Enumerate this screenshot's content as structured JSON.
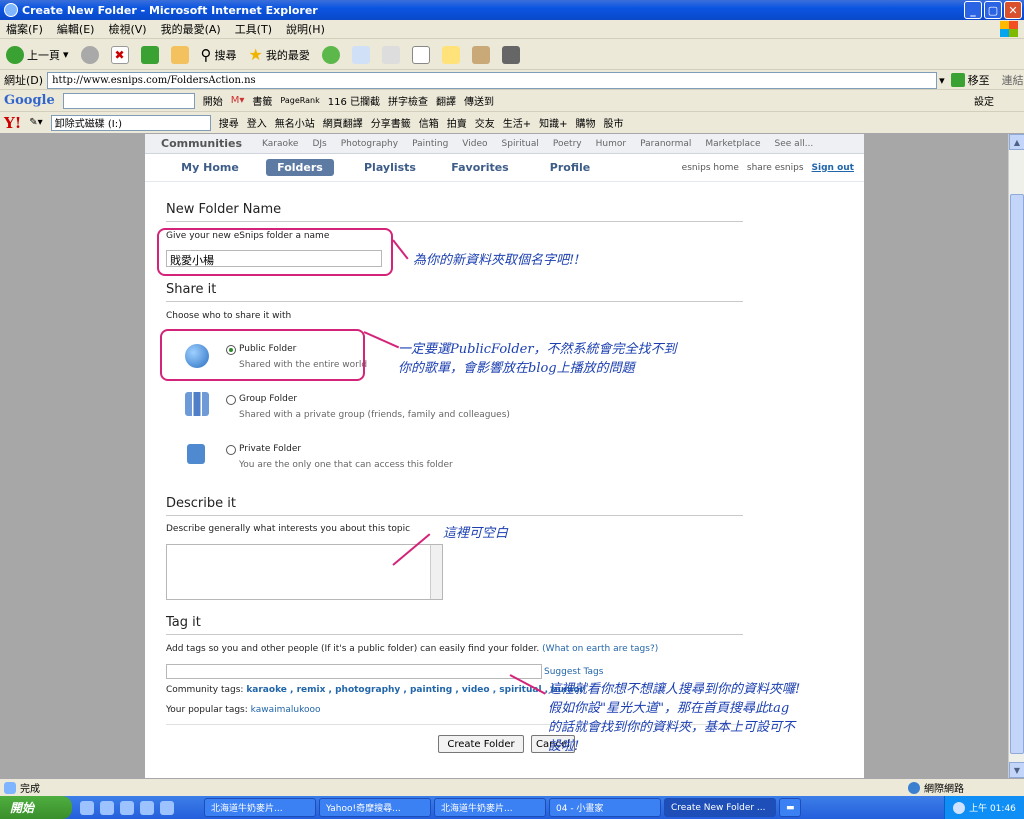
{
  "window": {
    "title": "Create New Folder - Microsoft Internet Explorer"
  },
  "menu": [
    "檔案(F)",
    "編輯(E)",
    "檢視(V)",
    "我的最愛(A)",
    "工具(T)",
    "說明(H)"
  ],
  "toolbar": {
    "back": "上一頁",
    "search": "搜尋",
    "favorites": "我的最愛"
  },
  "address": {
    "label": "網址(D)",
    "url": "http://www.esnips.com/FoldersAction.ns",
    "go": "移至",
    "links": "連結"
  },
  "google_bar": {
    "logo": "Google",
    "search_button": "開始",
    "pagerank": "PageRank",
    "blocked": "116 已攔截",
    "spell": "拼字檢查",
    "translate": "翻譯",
    "send": "傳送到",
    "settings": "設定",
    "bookmarks": "書籤"
  },
  "yahoo_bar": {
    "logo": "Y!",
    "input": "卸除式磁碟 (I:)",
    "search": "搜尋",
    "login": "登入",
    "items": [
      "無名小站",
      "網頁翻譯",
      "分享書籤",
      "信箱",
      "拍賣",
      "交友",
      "生活+",
      "知識+",
      "購物",
      "股市"
    ]
  },
  "community_nav": {
    "title": "Communities",
    "items": [
      "Karaoke",
      "DJs",
      "Photography",
      "Painting",
      "Video",
      "Spiritual",
      "Poetry",
      "Humor",
      "Paranormal",
      "Marketplace",
      "See all..."
    ]
  },
  "main_nav": {
    "tabs": [
      "My Home",
      "Folders",
      "Playlists",
      "Favorites",
      "Profile"
    ],
    "right": [
      "esnips home",
      "share esnips",
      "Sign out"
    ]
  },
  "form": {
    "name_title": "New Folder Name",
    "name_hint": "Give your new eSnips folder a name",
    "name_value": "戝愛小楊",
    "share_title": "Share it",
    "share_hint": "Choose who to share it with",
    "options": [
      {
        "title": "Public Folder",
        "desc": "Shared with the entire world",
        "selected": true
      },
      {
        "title": "Group Folder",
        "desc": "Shared with a private group (friends, family and colleagues)",
        "selected": false
      },
      {
        "title": "Private Folder",
        "desc": "You are the only one that can access this folder",
        "selected": false
      }
    ],
    "describe_title": "Describe it",
    "describe_hint": "Describe generally what interests you about this topic",
    "tag_title": "Tag it",
    "tag_hint": "Add tags so you and other people (If it's a public folder) can easily find your folder.",
    "tag_help": "(What on earth are tags?)",
    "suggest": "Suggest Tags",
    "community_tags_label": "Community tags:",
    "community_tags": "karaoke , remix , photography , painting , video , spiritual , humor",
    "popular_tags_label": "Your popular tags:",
    "popular_tags": "kawaimalukooo",
    "create": "Create Folder",
    "cancel": "Cancel"
  },
  "annotations": {
    "a1": "為你的新資料夾取個名字吧!!",
    "a2_l1": "一定要選PublicFolder，不然系統會完全找不到",
    "a2_l2": "你的歌單，會影響放在blog上播放的問題",
    "a3": "這裡可空白",
    "a4_l1": "這裡就看你想不想讓人搜尋到你的資料夾囉!",
    "a4_l2": "假如你設\"星光大道\"，那在首頁搜尋此tag",
    "a4_l3": "的話就會找到你的資料夾，基本上可設可不",
    "a4_l4": "設啦!"
  },
  "status": {
    "left": "完成",
    "zone": "網際網路"
  },
  "taskbar": {
    "start": "開始",
    "tasks": [
      "北海道牛奶麥片...",
      "Yahoo!奇摩搜尋...",
      "北海道牛奶麥片...",
      "04 - 小畫家",
      "Create New Folder ..."
    ],
    "clock": "上午 01:46"
  }
}
